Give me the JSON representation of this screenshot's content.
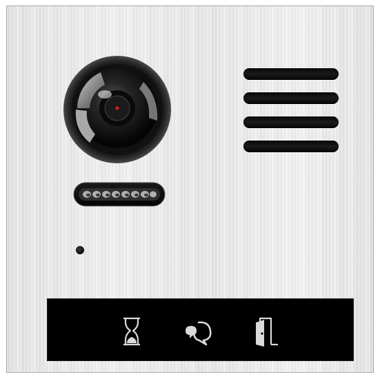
{
  "device": {
    "name": "",
    "panel_finish_color": "#e8e8e8",
    "indicator_bar_color": "#000000",
    "icon_color": "#d9d9d9"
  },
  "camera": {
    "icon": "camera-lens-icon"
  },
  "speaker": {
    "slot_count": 4,
    "icon": "speaker-grille"
  },
  "ir_sensor": {
    "icon": "ir-led-strip"
  },
  "microphone": {
    "icon": "microphone-hole"
  },
  "status_indicators": [
    {
      "icon": "hourglass-icon",
      "meaning": ""
    },
    {
      "icon": "speech-bubbles-icon",
      "meaning": ""
    },
    {
      "icon": "door-icon",
      "meaning": ""
    }
  ]
}
